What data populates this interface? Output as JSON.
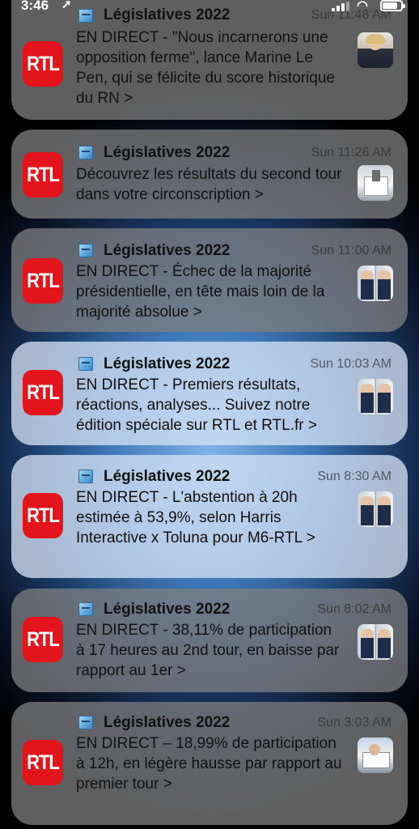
{
  "status_bar": {
    "time": "3:46",
    "location_glyph": "➚",
    "wifi_glyph": "◠"
  },
  "notifications": [
    {
      "app_icon": "ballot-box-icon",
      "title": "Législatives 2022",
      "time": "Sun 11:48 AM",
      "text": "EN DIRECT - \"Nous incarnerons une opposition ferme\", lance Marine Le Pen, qui se félicite du score historique du RN >",
      "logo": "RTL",
      "thumbnail": "portrait"
    },
    {
      "app_icon": "ballot-box-icon",
      "title": "Législatives 2022",
      "time": "Sun 11:26 AM",
      "text": "Découvrez les résultats du second tour dans votre circonscription >",
      "logo": "RTL",
      "thumbnail": "ballot"
    },
    {
      "app_icon": "ballot-box-icon",
      "title": "Législatives 2022",
      "time": "Sun 11:00 AM",
      "text": "EN DIRECT - Échec de la majorité présidentielle, en tête mais loin de la majorité absolue >",
      "logo": "RTL",
      "thumbnail": "duo"
    },
    {
      "app_icon": "ballot-box-icon",
      "title": "Législatives 2022",
      "time": "Sun 10:03 AM",
      "text": "EN DIRECT - Premiers résultats, réactions, analyses... Suivez notre édition spéciale sur RTL et RTL.fr >",
      "logo": "RTL",
      "thumbnail": "duo"
    },
    {
      "app_icon": "ballot-box-icon",
      "title": "Législatives 2022",
      "time": "Sun 8:30 AM",
      "text": "EN DIRECT - L'abstention à 20h estimée à 53,9%, selon Harris Interactive x Toluna pour M6-RTL >",
      "logo": "RTL",
      "thumbnail": "duo"
    },
    {
      "app_icon": "ballot-box-icon",
      "title": "Législatives 2022",
      "time": "Sun 8:02 AM",
      "text": "EN DIRECT - 38,11% de participation à 17 heures au 2nd tour, en baisse par rapport au 1er >",
      "logo": "RTL",
      "thumbnail": "duo"
    },
    {
      "app_icon": "ballot-box-icon",
      "title": "Législatives 2022",
      "time": "Sun 3:03 AM",
      "text": "EN DIRECT – 18,99% de participation à 12h, en légère hausse par rapport au premier tour >",
      "logo": "RTL",
      "thumbnail": "voter"
    }
  ],
  "colors": {
    "rtl_red": "#e3141c"
  }
}
